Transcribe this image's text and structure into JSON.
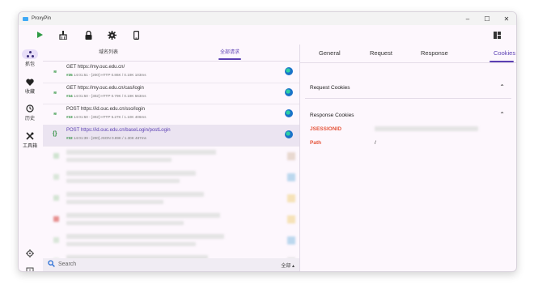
{
  "window": {
    "title": "ProxyPin",
    "controls": {
      "minimize": "–",
      "maximize": "☐",
      "close": "✕"
    }
  },
  "toolbar": {
    "icons": [
      "play-icon",
      "broom-icon",
      "lock-icon",
      "gear-icon",
      "phone-icon"
    ],
    "right_icon": "layout-icon"
  },
  "sidebar": {
    "items": [
      {
        "label": "抓包",
        "icon": "network-icon"
      },
      {
        "label": "收藏",
        "icon": "heart-icon"
      },
      {
        "label": "历史",
        "icon": "history-icon"
      },
      {
        "label": "工具箱",
        "icon": "tools-icon"
      }
    ],
    "bottom_icons": [
      "settings-icon",
      "feedback-icon"
    ]
  },
  "list": {
    "tabs": [
      {
        "label": "域名列表"
      },
      {
        "label": "全部请求"
      }
    ],
    "active_tab": 1,
    "rows": [
      {
        "title": "GET https://my.ouc.edu.cn/",
        "num": "#35",
        "detail": "14:01:51 - [200]  HTTP 0.86K / 0.19K  103ms",
        "icon": "wifi-icon"
      },
      {
        "title": "GET https://my.ouc.edu.cn/cas/login",
        "num": "#34",
        "detail": "14:01:50 - [302]  HTTP 0.79K / 0.19K  563ms",
        "icon": "wifi-icon"
      },
      {
        "title": "POST https://id.ouc.edu.cn/sso/login",
        "num": "#33",
        "detail": "14:01:50 - [302]  HTTP 5.27K / 1.10K  406ms",
        "icon": "wifi-icon"
      },
      {
        "title": "POST https://id.ouc.edu.cn/baseLogin/postLogin",
        "num": "#32",
        "detail": "14:01:39 - [200]  JSON 0.89K / 1.30K  487ms",
        "icon": "json-icon",
        "selected": true
      }
    ]
  },
  "search": {
    "placeholder": "Search",
    "filter": "全部 ▴"
  },
  "detail": {
    "tabs": [
      {
        "label": "General"
      },
      {
        "label": "Request"
      },
      {
        "label": "Response"
      },
      {
        "label": "Cookies"
      }
    ],
    "active_tab": 3,
    "request_cookies_title": "Request Cookies",
    "response_cookies_title": "Response Cookies",
    "cookies": [
      {
        "key": "JSESSIONID",
        "value": ""
      },
      {
        "key": "Path",
        "value": "/"
      }
    ]
  },
  "colors": {
    "accent": "#5b3fb3",
    "cookie_key": "#e5553b",
    "status_icon": "#3b9a4a"
  }
}
